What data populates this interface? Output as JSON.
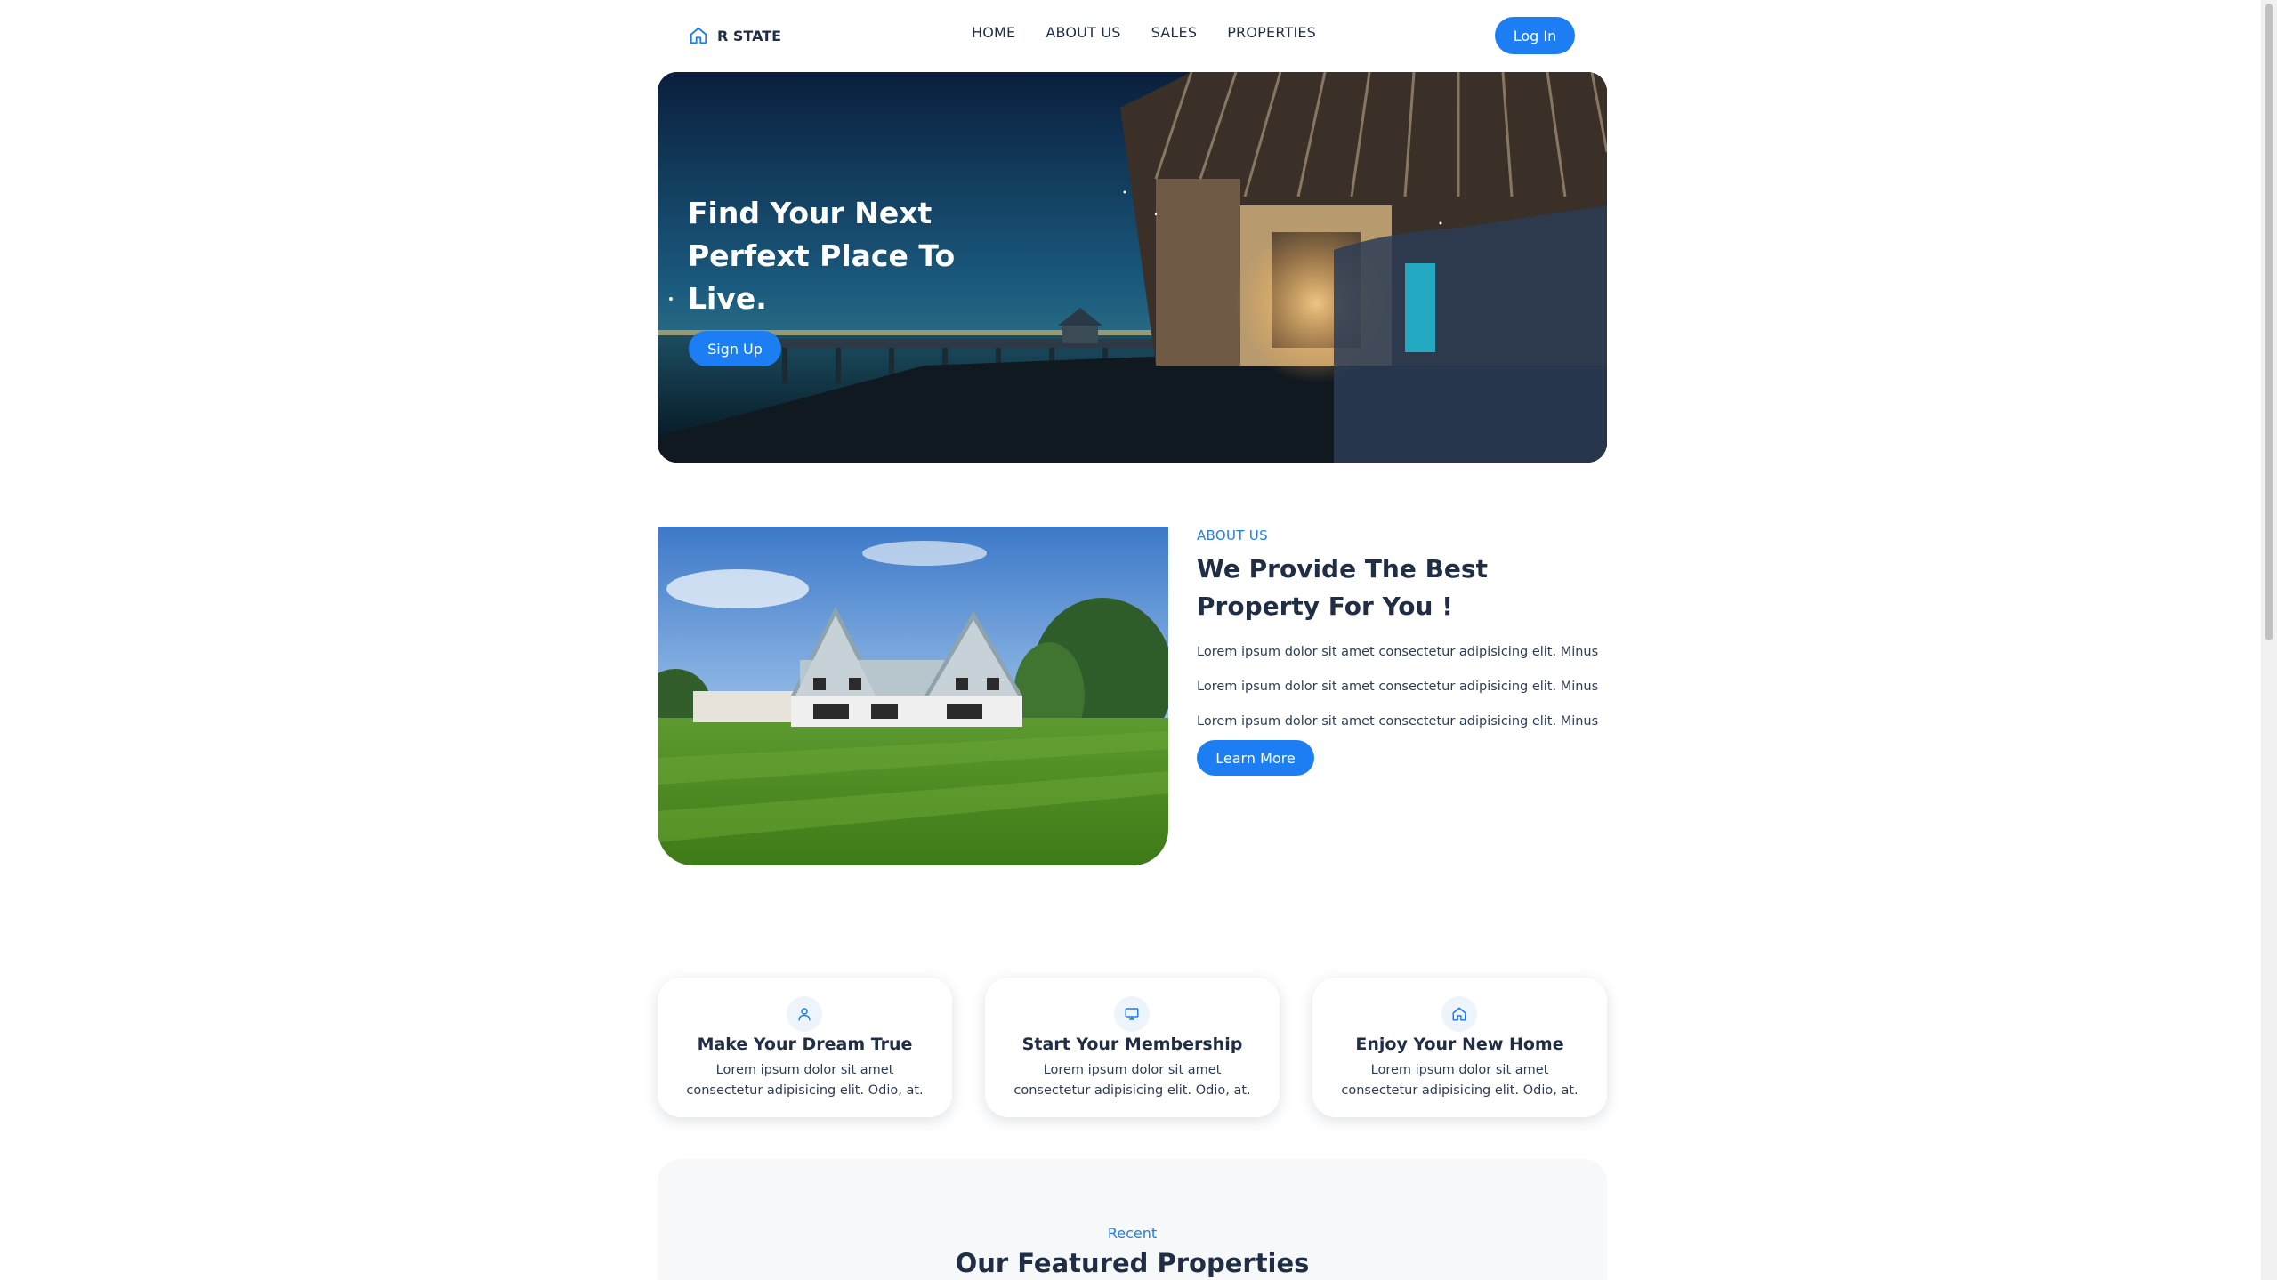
{
  "brand": {
    "name": "R STATE",
    "icon": "home-icon"
  },
  "nav": {
    "links": [
      "HOME",
      "ABOUT US",
      "SALES",
      "PROPERTIES"
    ],
    "login_label": "Log In"
  },
  "hero": {
    "title": "Find Your Next Perfext Place To Live.",
    "signup_label": "Sign Up"
  },
  "about": {
    "kicker": "ABOUT US",
    "heading": "We Provide The Best Property For You !",
    "paragraphs": [
      "Lorem ipsum dolor sit amet consectetur adipisicing elit. Minus",
      "Lorem ipsum dolor sit amet consectetur adipisicing elit. Minus",
      "Lorem ipsum dolor sit amet consectetur adipisicing elit. Minus"
    ],
    "button_label": "Learn More"
  },
  "features": [
    {
      "icon": "user-icon",
      "title": "Make Your Dream True",
      "description": "Lorem ipsum dolor sit amet consectetur adipisicing elit. Odio, at."
    },
    {
      "icon": "monitor-icon",
      "title": "Start Your Membership",
      "description": "Lorem ipsum dolor sit amet consectetur adipisicing elit. Odio, at."
    },
    {
      "icon": "home-icon",
      "title": "Enjoy Your New Home",
      "description": "Lorem ipsum dolor sit amet consectetur adipisicing elit. Odio, at."
    }
  ],
  "featured": {
    "kicker": "Recent",
    "title": "Our Featured Properties"
  },
  "colors": {
    "accent": "#1d7df2",
    "text_dark": "#1f2d45",
    "section_bg": "#f7f8fa"
  }
}
